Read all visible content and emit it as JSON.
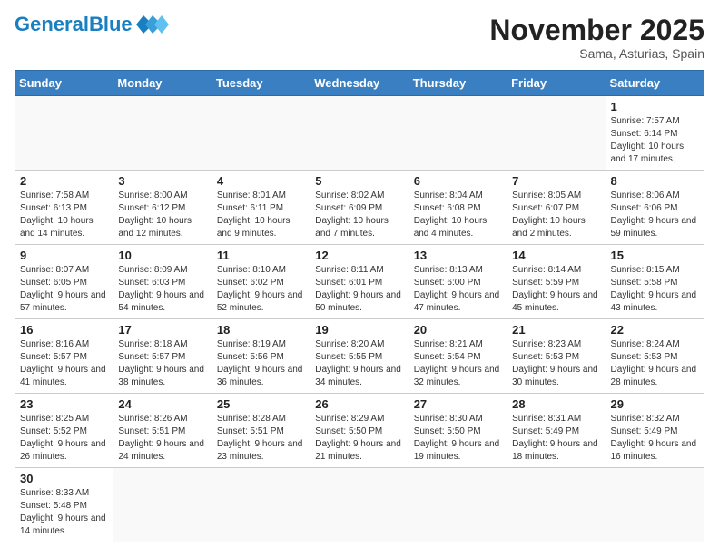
{
  "header": {
    "logo_general": "General",
    "logo_blue": "Blue",
    "month_title": "November 2025",
    "location": "Sama, Asturias, Spain"
  },
  "days_of_week": [
    "Sunday",
    "Monday",
    "Tuesday",
    "Wednesday",
    "Thursday",
    "Friday",
    "Saturday"
  ],
  "weeks": [
    [
      {
        "day": "",
        "info": ""
      },
      {
        "day": "",
        "info": ""
      },
      {
        "day": "",
        "info": ""
      },
      {
        "day": "",
        "info": ""
      },
      {
        "day": "",
        "info": ""
      },
      {
        "day": "",
        "info": ""
      },
      {
        "day": "1",
        "info": "Sunrise: 7:57 AM\nSunset: 6:14 PM\nDaylight: 10 hours and 17 minutes."
      }
    ],
    [
      {
        "day": "2",
        "info": "Sunrise: 7:58 AM\nSunset: 6:13 PM\nDaylight: 10 hours and 14 minutes."
      },
      {
        "day": "3",
        "info": "Sunrise: 8:00 AM\nSunset: 6:12 PM\nDaylight: 10 hours and 12 minutes."
      },
      {
        "day": "4",
        "info": "Sunrise: 8:01 AM\nSunset: 6:11 PM\nDaylight: 10 hours and 9 minutes."
      },
      {
        "day": "5",
        "info": "Sunrise: 8:02 AM\nSunset: 6:09 PM\nDaylight: 10 hours and 7 minutes."
      },
      {
        "day": "6",
        "info": "Sunrise: 8:04 AM\nSunset: 6:08 PM\nDaylight: 10 hours and 4 minutes."
      },
      {
        "day": "7",
        "info": "Sunrise: 8:05 AM\nSunset: 6:07 PM\nDaylight: 10 hours and 2 minutes."
      },
      {
        "day": "8",
        "info": "Sunrise: 8:06 AM\nSunset: 6:06 PM\nDaylight: 9 hours and 59 minutes."
      }
    ],
    [
      {
        "day": "9",
        "info": "Sunrise: 8:07 AM\nSunset: 6:05 PM\nDaylight: 9 hours and 57 minutes."
      },
      {
        "day": "10",
        "info": "Sunrise: 8:09 AM\nSunset: 6:03 PM\nDaylight: 9 hours and 54 minutes."
      },
      {
        "day": "11",
        "info": "Sunrise: 8:10 AM\nSunset: 6:02 PM\nDaylight: 9 hours and 52 minutes."
      },
      {
        "day": "12",
        "info": "Sunrise: 8:11 AM\nSunset: 6:01 PM\nDaylight: 9 hours and 50 minutes."
      },
      {
        "day": "13",
        "info": "Sunrise: 8:13 AM\nSunset: 6:00 PM\nDaylight: 9 hours and 47 minutes."
      },
      {
        "day": "14",
        "info": "Sunrise: 8:14 AM\nSunset: 5:59 PM\nDaylight: 9 hours and 45 minutes."
      },
      {
        "day": "15",
        "info": "Sunrise: 8:15 AM\nSunset: 5:58 PM\nDaylight: 9 hours and 43 minutes."
      }
    ],
    [
      {
        "day": "16",
        "info": "Sunrise: 8:16 AM\nSunset: 5:57 PM\nDaylight: 9 hours and 41 minutes."
      },
      {
        "day": "17",
        "info": "Sunrise: 8:18 AM\nSunset: 5:57 PM\nDaylight: 9 hours and 38 minutes."
      },
      {
        "day": "18",
        "info": "Sunrise: 8:19 AM\nSunset: 5:56 PM\nDaylight: 9 hours and 36 minutes."
      },
      {
        "day": "19",
        "info": "Sunrise: 8:20 AM\nSunset: 5:55 PM\nDaylight: 9 hours and 34 minutes."
      },
      {
        "day": "20",
        "info": "Sunrise: 8:21 AM\nSunset: 5:54 PM\nDaylight: 9 hours and 32 minutes."
      },
      {
        "day": "21",
        "info": "Sunrise: 8:23 AM\nSunset: 5:53 PM\nDaylight: 9 hours and 30 minutes."
      },
      {
        "day": "22",
        "info": "Sunrise: 8:24 AM\nSunset: 5:53 PM\nDaylight: 9 hours and 28 minutes."
      }
    ],
    [
      {
        "day": "23",
        "info": "Sunrise: 8:25 AM\nSunset: 5:52 PM\nDaylight: 9 hours and 26 minutes."
      },
      {
        "day": "24",
        "info": "Sunrise: 8:26 AM\nSunset: 5:51 PM\nDaylight: 9 hours and 24 minutes."
      },
      {
        "day": "25",
        "info": "Sunrise: 8:28 AM\nSunset: 5:51 PM\nDaylight: 9 hours and 23 minutes."
      },
      {
        "day": "26",
        "info": "Sunrise: 8:29 AM\nSunset: 5:50 PM\nDaylight: 9 hours and 21 minutes."
      },
      {
        "day": "27",
        "info": "Sunrise: 8:30 AM\nSunset: 5:50 PM\nDaylight: 9 hours and 19 minutes."
      },
      {
        "day": "28",
        "info": "Sunrise: 8:31 AM\nSunset: 5:49 PM\nDaylight: 9 hours and 18 minutes."
      },
      {
        "day": "29",
        "info": "Sunrise: 8:32 AM\nSunset: 5:49 PM\nDaylight: 9 hours and 16 minutes."
      }
    ],
    [
      {
        "day": "30",
        "info": "Sunrise: 8:33 AM\nSunset: 5:48 PM\nDaylight: 9 hours and 14 minutes."
      },
      {
        "day": "",
        "info": ""
      },
      {
        "day": "",
        "info": ""
      },
      {
        "day": "",
        "info": ""
      },
      {
        "day": "",
        "info": ""
      },
      {
        "day": "",
        "info": ""
      },
      {
        "day": "",
        "info": ""
      }
    ]
  ]
}
